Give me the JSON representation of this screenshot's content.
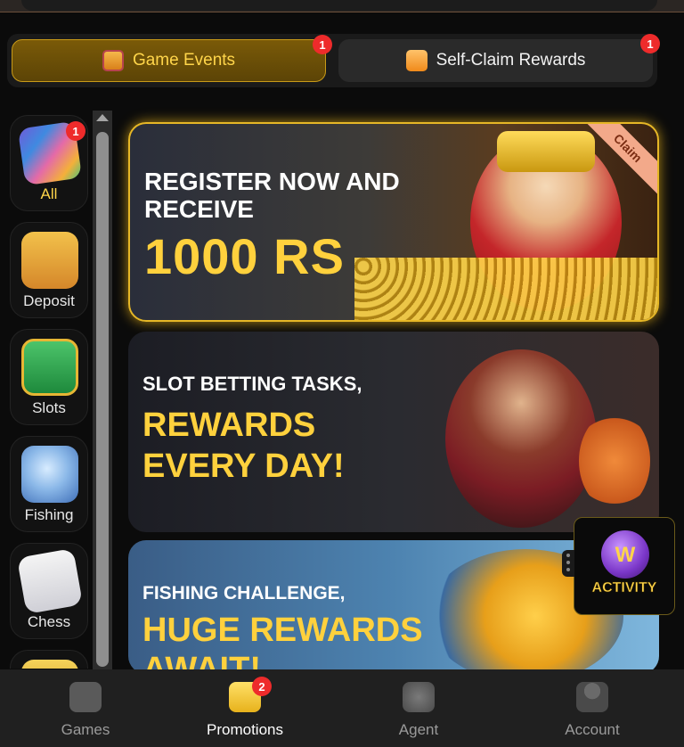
{
  "tabs": {
    "game_events": {
      "label": "Game Events",
      "badge": "1",
      "icon": "gift-calendar-icon"
    },
    "self_claim": {
      "label": "Self-Claim Rewards",
      "badge": "1",
      "icon": "gift-box-icon"
    }
  },
  "sidebar": {
    "items": [
      {
        "label": "All",
        "badge": "1",
        "icon": "cube-icon"
      },
      {
        "label": "Deposit",
        "icon": "wallet-icon"
      },
      {
        "label": "Slots",
        "icon": "slot-machine-icon"
      },
      {
        "label": "Fishing",
        "icon": "fish-icon"
      },
      {
        "label": "Chess",
        "icon": "cards-icon"
      }
    ]
  },
  "banners": {
    "register": {
      "line1": "REGISTER NOW AND",
      "line2": "RECEIVE",
      "line3": "1000 RS",
      "ribbon": "Claim"
    },
    "slot": {
      "line1": "SLOT BETTING TASKS,",
      "line2": "REWARDS",
      "line3": "EVERY DAY!"
    },
    "fishing": {
      "line1": "FISHING CHALLENGE,",
      "line2": "HUGE REWARDS",
      "line3": "AWAIT!"
    }
  },
  "activity": {
    "label": "ACTIVITY",
    "letter": "W"
  },
  "nav": {
    "games": {
      "label": "Games",
      "icon": "gamepad-icon"
    },
    "promotions": {
      "label": "Promotions",
      "badge": "2",
      "icon": "gift-box-icon"
    },
    "agent": {
      "label": "Agent",
      "icon": "coin-stack-icon"
    },
    "account": {
      "label": "Account",
      "icon": "user-icon"
    }
  },
  "colors": {
    "accent": "#ffd54a",
    "badge": "#ee2b2b",
    "background": "#0b0b0b"
  }
}
